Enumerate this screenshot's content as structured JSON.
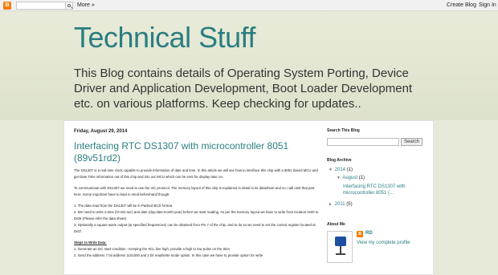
{
  "navbar": {
    "logo_glyph": "B",
    "more_label": "More »",
    "create_blog": "Create Blog",
    "sign_in": "Sign In"
  },
  "header": {
    "title": "Technical Stuff",
    "description": "This Blog contains details of Operating System Porting, Device Driver and Application Development, Boot Loader Development etc. on various platforms. Keep checking for updates.."
  },
  "post": {
    "date": "Friday, August 29, 2014",
    "title": "Interfacing RTC DS1307 with microcontroller 8051 (89v51rd2)",
    "paragraphs": [
      "The DS1307 is a real time clock capable to provide information of date and time. In this article we will see how to interface this chip with a 8051 based MCU and get Date Time information out of this chip and into our MCU which can be sent for display later on.",
      "To communicate with DS1307 we need to use the I2C protocol. The memory layout of this chip is explained in detail in its datasheet and so I will omit that part here. Some important have to kept in mind beforehand though:",
      "1. The data read from the DS1307 will be in Packed BCD format.",
      "2. We need to write a time (hr:min:sec) and date (day:date:month:year) before we start reading. As per the memory layout we have to write from location 0x00 to 0x06 (Please refer the data sheet).",
      "3. Optionally a square wave output (at specified frequencies) can be obtained from Pin 7 of the chip, and to do so we need to set the control register located at   0x07."
    ],
    "steps_heading": "Steps to Write Data:",
    "steps": [
      "1. Generate an I2C start condition - Keeping the SCL line high, provide a high to low pulse on the SDA.",
      "2. Send the address 7 bit address 1101000 and 1 bit read/write mode option. In this case we have to provide option for write"
    ]
  },
  "sidebar": {
    "search_heading": "Search This Blog",
    "search_value": "",
    "search_button": "Search",
    "archive_heading": "Blog Archive",
    "archive": {
      "year_2014": "2014",
      "year_2014_count": "(1)",
      "month_aug": "August",
      "month_aug_count": "(1)",
      "post_link": "Interfacing RTC DS1307 with microcontroller 8051 (...",
      "year_2011": "2011",
      "year_2011_count": "(5)"
    },
    "about_heading": "About Me",
    "author_name": "RD",
    "profile_link": "View my complete profile"
  },
  "icons": {
    "triangle_open": "▼",
    "triangle_closed": "►"
  },
  "colors": {
    "accent": "#2a7e80",
    "blogger_orange": "#f57d00"
  }
}
